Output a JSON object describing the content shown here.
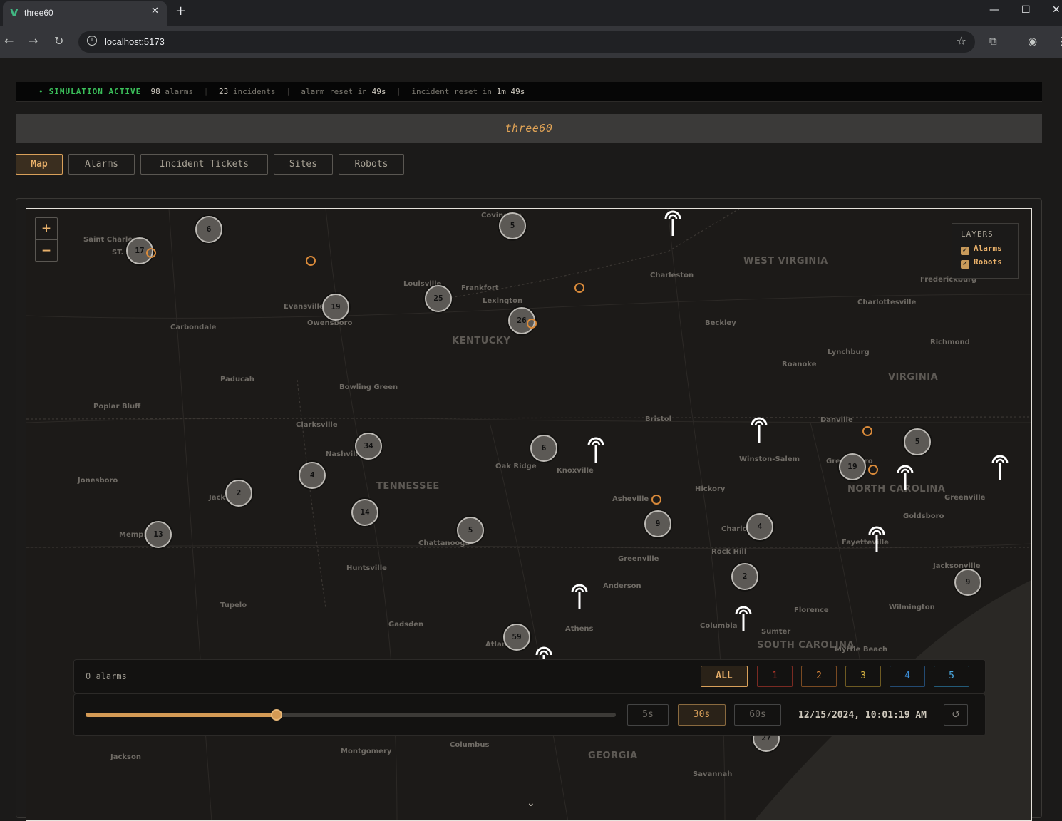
{
  "browser": {
    "tab_title": "three60",
    "tab_logo": "V",
    "url": "localhost:5173"
  },
  "status": {
    "label": "SIMULATION ACTIVE",
    "alarms_count": "98",
    "alarms_word": "alarms",
    "incidents_count": "23",
    "incidents_word": "incidents",
    "alarm_reset_prefix": "alarm reset in",
    "alarm_reset_value": "49s",
    "incident_reset_prefix": "incident reset in",
    "incident_reset_value": "1m 49s"
  },
  "app": {
    "title": "three60"
  },
  "nav": {
    "tabs": [
      {
        "label": "Map",
        "active": true
      },
      {
        "label": "Alarms",
        "active": false
      },
      {
        "label": "Incident Tickets",
        "active": false
      },
      {
        "label": "Sites",
        "active": false
      },
      {
        "label": "Robots",
        "active": false
      }
    ]
  },
  "map": {
    "zoom_in": "+",
    "zoom_out": "−",
    "layers": {
      "title": "LAYERS",
      "items": [
        {
          "label": "Alarms",
          "checked": true
        },
        {
          "label": "Robots",
          "checked": true
        }
      ]
    },
    "clusters": [
      "17",
      "6",
      "5",
      "19",
      "25",
      "26",
      "34",
      "6",
      "4",
      "2",
      "14",
      "13",
      "5",
      "9",
      "4",
      "2",
      "19",
      "5",
      "9",
      "59",
      "27"
    ],
    "labels": {
      "states": [
        "WEST VIRGINIA",
        "KENTUCKY",
        "VIRGINIA",
        "TENNESSEE",
        "NORTH CAROLINA",
        "SOUTH CAROLINA",
        "GEORGIA"
      ],
      "cities": [
        "Saint Charles",
        "ST. LOUIS",
        "Covington",
        "Charleston",
        "Frankfort",
        "Louisville",
        "Lexington",
        "Evansville",
        "Owensboro",
        "Carbondale",
        "Beckley",
        "Charlottesville",
        "Richmond",
        "Frederickburg",
        "Lynchburg",
        "Roanoke",
        "Paducah",
        "Bowling Green",
        "Poplar Bluff",
        "Clarksville",
        "Nashville",
        "Bristol",
        "Danville",
        "Winston-Salem",
        "Greensboro",
        "Oak Ridge",
        "Knoxville",
        "Jonesboro",
        "Jackson",
        "Asheville",
        "Hickory",
        "Greenville",
        "Goldsboro",
        "Memphis",
        "Chattanooga",
        "Charlotte",
        "Fayetteville",
        "Rock Hill",
        "Huntsville",
        "Greenville",
        "Anderson",
        "Jacksonville",
        "Tupelo",
        "Florence",
        "Wilmington",
        "Gadsden",
        "Athens",
        "Columbia",
        "Sumter",
        "Atlanta",
        "Myrtle Beach",
        "Montgomery",
        "Columbus",
        "Savannah",
        "Jackson"
      ]
    }
  },
  "alarm_panel": {
    "count_text": "0 alarms",
    "priority_buttons": [
      {
        "label": "ALL",
        "color": "#d9a05a"
      },
      {
        "label": "1",
        "color": "#c0392b"
      },
      {
        "label": "2",
        "color": "#d9853a"
      },
      {
        "label": "3",
        "color": "#d4b040"
      },
      {
        "label": "4",
        "color": "#3a8ed9"
      },
      {
        "label": "5",
        "color": "#4aa8e0"
      }
    ]
  },
  "timeline": {
    "progress": 0.36,
    "speeds": [
      {
        "label": "5s",
        "active": false
      },
      {
        "label": "30s",
        "active": true
      },
      {
        "label": "60s",
        "active": false
      }
    ],
    "datetime": "12/15/2024, 10:01:19 AM"
  }
}
